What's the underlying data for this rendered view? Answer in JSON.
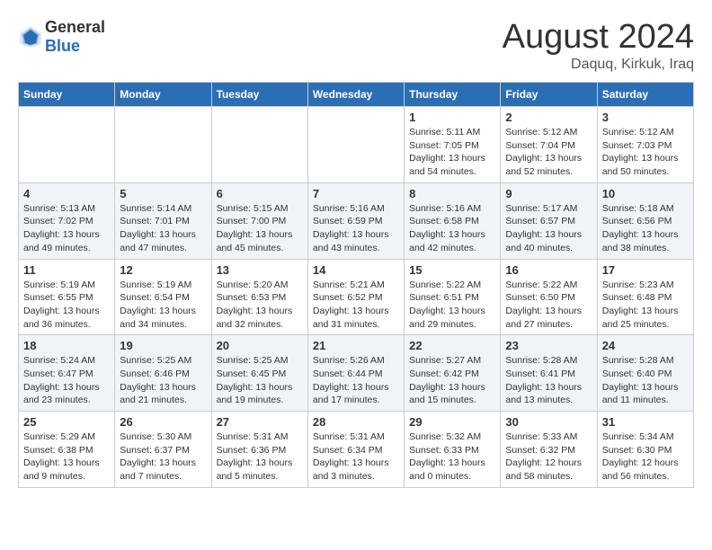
{
  "header": {
    "logo_general": "General",
    "logo_blue": "Blue",
    "month_year": "August 2024",
    "location": "Daquq, Kirkuk, Iraq"
  },
  "days_of_week": [
    "Sunday",
    "Monday",
    "Tuesday",
    "Wednesday",
    "Thursday",
    "Friday",
    "Saturday"
  ],
  "weeks": [
    [
      {
        "day": "",
        "content": ""
      },
      {
        "day": "",
        "content": ""
      },
      {
        "day": "",
        "content": ""
      },
      {
        "day": "",
        "content": ""
      },
      {
        "day": "1",
        "content": "Sunrise: 5:11 AM\nSunset: 7:05 PM\nDaylight: 13 hours\nand 54 minutes."
      },
      {
        "day": "2",
        "content": "Sunrise: 5:12 AM\nSunset: 7:04 PM\nDaylight: 13 hours\nand 52 minutes."
      },
      {
        "day": "3",
        "content": "Sunrise: 5:12 AM\nSunset: 7:03 PM\nDaylight: 13 hours\nand 50 minutes."
      }
    ],
    [
      {
        "day": "4",
        "content": "Sunrise: 5:13 AM\nSunset: 7:02 PM\nDaylight: 13 hours\nand 49 minutes."
      },
      {
        "day": "5",
        "content": "Sunrise: 5:14 AM\nSunset: 7:01 PM\nDaylight: 13 hours\nand 47 minutes."
      },
      {
        "day": "6",
        "content": "Sunrise: 5:15 AM\nSunset: 7:00 PM\nDaylight: 13 hours\nand 45 minutes."
      },
      {
        "day": "7",
        "content": "Sunrise: 5:16 AM\nSunset: 6:59 PM\nDaylight: 13 hours\nand 43 minutes."
      },
      {
        "day": "8",
        "content": "Sunrise: 5:16 AM\nSunset: 6:58 PM\nDaylight: 13 hours\nand 42 minutes."
      },
      {
        "day": "9",
        "content": "Sunrise: 5:17 AM\nSunset: 6:57 PM\nDaylight: 13 hours\nand 40 minutes."
      },
      {
        "day": "10",
        "content": "Sunrise: 5:18 AM\nSunset: 6:56 PM\nDaylight: 13 hours\nand 38 minutes."
      }
    ],
    [
      {
        "day": "11",
        "content": "Sunrise: 5:19 AM\nSunset: 6:55 PM\nDaylight: 13 hours\nand 36 minutes."
      },
      {
        "day": "12",
        "content": "Sunrise: 5:19 AM\nSunset: 6:54 PM\nDaylight: 13 hours\nand 34 minutes."
      },
      {
        "day": "13",
        "content": "Sunrise: 5:20 AM\nSunset: 6:53 PM\nDaylight: 13 hours\nand 32 minutes."
      },
      {
        "day": "14",
        "content": "Sunrise: 5:21 AM\nSunset: 6:52 PM\nDaylight: 13 hours\nand 31 minutes."
      },
      {
        "day": "15",
        "content": "Sunrise: 5:22 AM\nSunset: 6:51 PM\nDaylight: 13 hours\nand 29 minutes."
      },
      {
        "day": "16",
        "content": "Sunrise: 5:22 AM\nSunset: 6:50 PM\nDaylight: 13 hours\nand 27 minutes."
      },
      {
        "day": "17",
        "content": "Sunrise: 5:23 AM\nSunset: 6:48 PM\nDaylight: 13 hours\nand 25 minutes."
      }
    ],
    [
      {
        "day": "18",
        "content": "Sunrise: 5:24 AM\nSunset: 6:47 PM\nDaylight: 13 hours\nand 23 minutes."
      },
      {
        "day": "19",
        "content": "Sunrise: 5:25 AM\nSunset: 6:46 PM\nDaylight: 13 hours\nand 21 minutes."
      },
      {
        "day": "20",
        "content": "Sunrise: 5:25 AM\nSunset: 6:45 PM\nDaylight: 13 hours\nand 19 minutes."
      },
      {
        "day": "21",
        "content": "Sunrise: 5:26 AM\nSunset: 6:44 PM\nDaylight: 13 hours\nand 17 minutes."
      },
      {
        "day": "22",
        "content": "Sunrise: 5:27 AM\nSunset: 6:42 PM\nDaylight: 13 hours\nand 15 minutes."
      },
      {
        "day": "23",
        "content": "Sunrise: 5:28 AM\nSunset: 6:41 PM\nDaylight: 13 hours\nand 13 minutes."
      },
      {
        "day": "24",
        "content": "Sunrise: 5:28 AM\nSunset: 6:40 PM\nDaylight: 13 hours\nand 11 minutes."
      }
    ],
    [
      {
        "day": "25",
        "content": "Sunrise: 5:29 AM\nSunset: 6:38 PM\nDaylight: 13 hours\nand 9 minutes."
      },
      {
        "day": "26",
        "content": "Sunrise: 5:30 AM\nSunset: 6:37 PM\nDaylight: 13 hours\nand 7 minutes."
      },
      {
        "day": "27",
        "content": "Sunrise: 5:31 AM\nSunset: 6:36 PM\nDaylight: 13 hours\nand 5 minutes."
      },
      {
        "day": "28",
        "content": "Sunrise: 5:31 AM\nSunset: 6:34 PM\nDaylight: 13 hours\nand 3 minutes."
      },
      {
        "day": "29",
        "content": "Sunrise: 5:32 AM\nSunset: 6:33 PM\nDaylight: 13 hours\nand 0 minutes."
      },
      {
        "day": "30",
        "content": "Sunrise: 5:33 AM\nSunset: 6:32 PM\nDaylight: 12 hours\nand 58 minutes."
      },
      {
        "day": "31",
        "content": "Sunrise: 5:34 AM\nSunset: 6:30 PM\nDaylight: 12 hours\nand 56 minutes."
      }
    ]
  ]
}
